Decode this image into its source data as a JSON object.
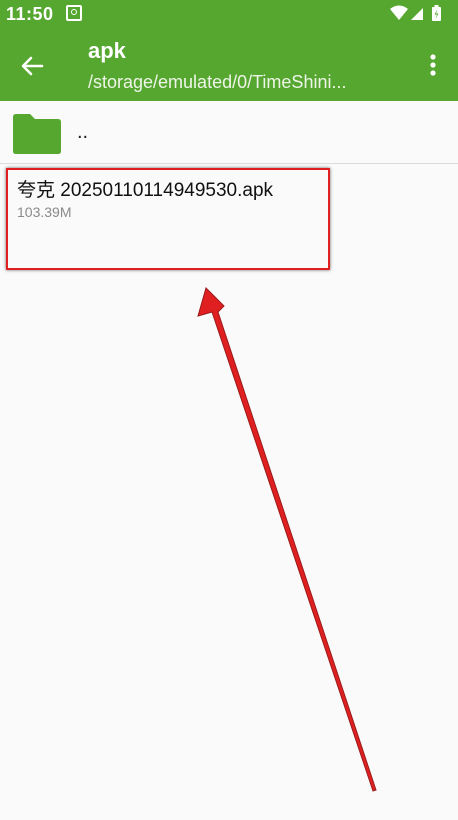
{
  "status_bar": {
    "time": "11:50",
    "icons": [
      "screenshot-icon",
      "wifi-icon",
      "signal-icon",
      "battery-icon"
    ]
  },
  "toolbar": {
    "title": "apk",
    "path": "/storage/emulated/0/TimeShini...",
    "back_icon": "back-arrow-icon",
    "menu_icon": "more-vert-icon"
  },
  "list": {
    "parent": {
      "label": "..",
      "icon": "folder-icon"
    },
    "files": [
      {
        "name": "夸克 20250110114949530.apk",
        "size": "103.39M"
      }
    ]
  },
  "colors": {
    "toolbar": "#55a72f",
    "folder": "#55a72f",
    "annotation": "#e02020"
  }
}
